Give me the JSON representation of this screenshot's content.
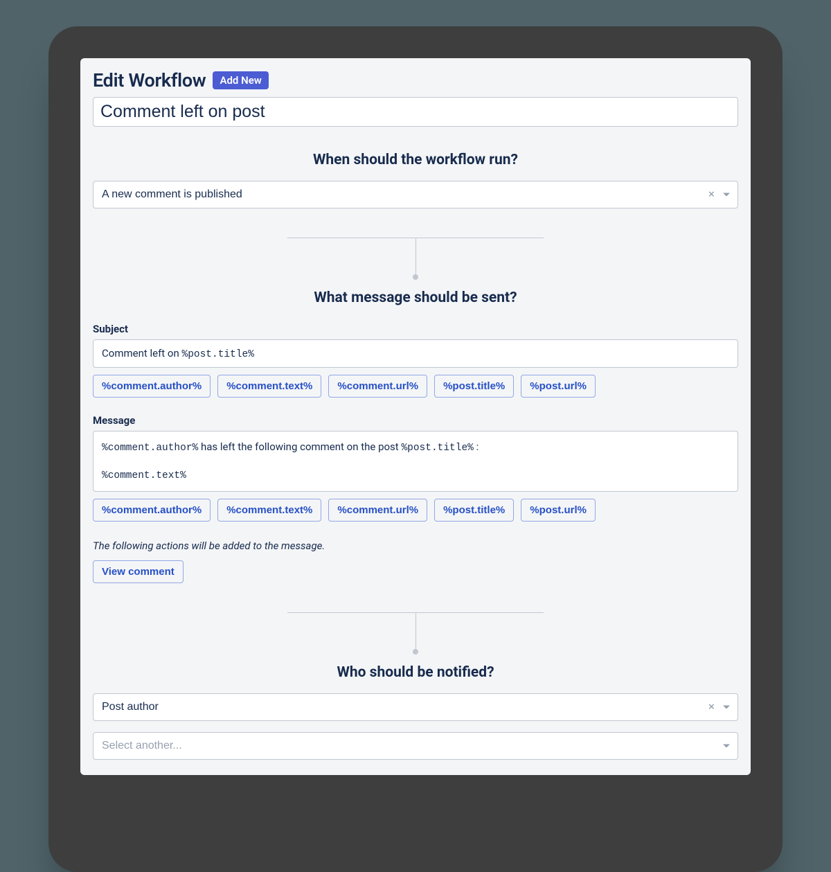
{
  "header": {
    "title": "Edit Workflow",
    "badge": "Add New"
  },
  "workflow_name": "Comment left on post",
  "sections": {
    "when": {
      "title": "When should the workflow run?",
      "trigger_value": "A new comment is published"
    },
    "message": {
      "title": "What message should be sent?",
      "subject_label": "Subject",
      "subject_prefix": "Comment left on ",
      "subject_token": "%post.title%",
      "body_label": "Message",
      "body_token1": "%comment.author%",
      "body_mid": " has left the following comment on the post ",
      "body_token2": "%post.title%",
      "body_tail": " :",
      "body_token3": "%comment.text%",
      "tokens": {
        "t0": "%comment.author%",
        "t1": "%comment.text%",
        "t2": "%comment.url%",
        "t3": "%post.title%",
        "t4": "%post.url%"
      },
      "actions_note": "The following actions will be added to the message.",
      "action_button": "View comment"
    },
    "who": {
      "title": "Who should be notified?",
      "recipient_value": "Post author",
      "add_placeholder": "Select another..."
    }
  }
}
